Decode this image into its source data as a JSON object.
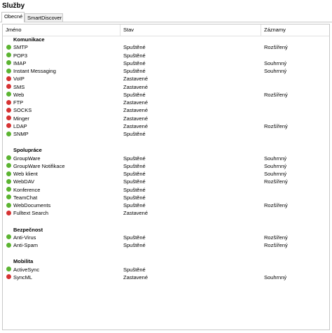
{
  "window": {
    "title": "Služby"
  },
  "tabs": [
    {
      "label": "Obecné",
      "active": true
    },
    {
      "label": "SmartDiscover",
      "active": false
    }
  ],
  "columns": {
    "name": "Jméno",
    "status": "Stav",
    "logs": "Záznamy"
  },
  "colors": {
    "running": "#5bb431",
    "stopped": "#d63232"
  },
  "groups": [
    {
      "name": "Komunikace",
      "services": [
        {
          "name": "SMTP",
          "status": "Spuštěné",
          "state": "running",
          "logs": "Rozšířený"
        },
        {
          "name": "POP3",
          "status": "Spuštěné",
          "state": "running",
          "logs": ""
        },
        {
          "name": "IMAP",
          "status": "Spuštěné",
          "state": "running",
          "logs": "Souhrnný"
        },
        {
          "name": "Instant Messaging",
          "status": "Spuštěné",
          "state": "running",
          "logs": "Souhrnný"
        },
        {
          "name": "VoIP",
          "status": "Zastavené",
          "state": "stopped",
          "logs": ""
        },
        {
          "name": "SMS",
          "status": "Zastavené",
          "state": "stopped",
          "logs": ""
        },
        {
          "name": "Web",
          "status": "Spuštěné",
          "state": "running",
          "logs": "Rozšířený"
        },
        {
          "name": "FTP",
          "status": "Zastavené",
          "state": "stopped",
          "logs": ""
        },
        {
          "name": "SOCKS",
          "status": "Zastavené",
          "state": "stopped",
          "logs": ""
        },
        {
          "name": "Minger",
          "status": "Zastavené",
          "state": "stopped",
          "logs": ""
        },
        {
          "name": "LDAP",
          "status": "Zastavené",
          "state": "stopped",
          "logs": "Rozšířený"
        },
        {
          "name": "SNMP",
          "status": "Spuštěné",
          "state": "running",
          "logs": ""
        }
      ]
    },
    {
      "name": "Spolupráce",
      "services": [
        {
          "name": "GroupWare",
          "status": "Spuštěné",
          "state": "running",
          "logs": "Souhrnný"
        },
        {
          "name": "GroupWare Notifikace",
          "status": "Spuštěné",
          "state": "running",
          "logs": "Souhrnný"
        },
        {
          "name": "Web klient",
          "status": "Spuštěné",
          "state": "running",
          "logs": "Souhrnný"
        },
        {
          "name": "WebDAV",
          "status": "Spuštěné",
          "state": "running",
          "logs": "Rozšířený"
        },
        {
          "name": "Konference",
          "status": "Spuštěné",
          "state": "running",
          "logs": ""
        },
        {
          "name": "TeamChat",
          "status": "Spuštěné",
          "state": "running",
          "logs": ""
        },
        {
          "name": "WebDocuments",
          "status": "Spuštěné",
          "state": "running",
          "logs": "Rozšířený"
        },
        {
          "name": "Fulltext Search",
          "status": "Zastavené",
          "state": "stopped",
          "logs": ""
        }
      ]
    },
    {
      "name": "Bezpečnost",
      "services": [
        {
          "name": "Anti-Virus",
          "status": "Spuštěné",
          "state": "running",
          "logs": "Rozšířený"
        },
        {
          "name": "Anti-Spam",
          "status": "Spuštěné",
          "state": "running",
          "logs": "Rozšířený"
        }
      ]
    },
    {
      "name": "Mobilita",
      "services": [
        {
          "name": "ActiveSync",
          "status": "Spuštěné",
          "state": "running",
          "logs": ""
        },
        {
          "name": "SyncML",
          "status": "Zastavené",
          "state": "stopped",
          "logs": "Souhrnný"
        }
      ]
    }
  ]
}
